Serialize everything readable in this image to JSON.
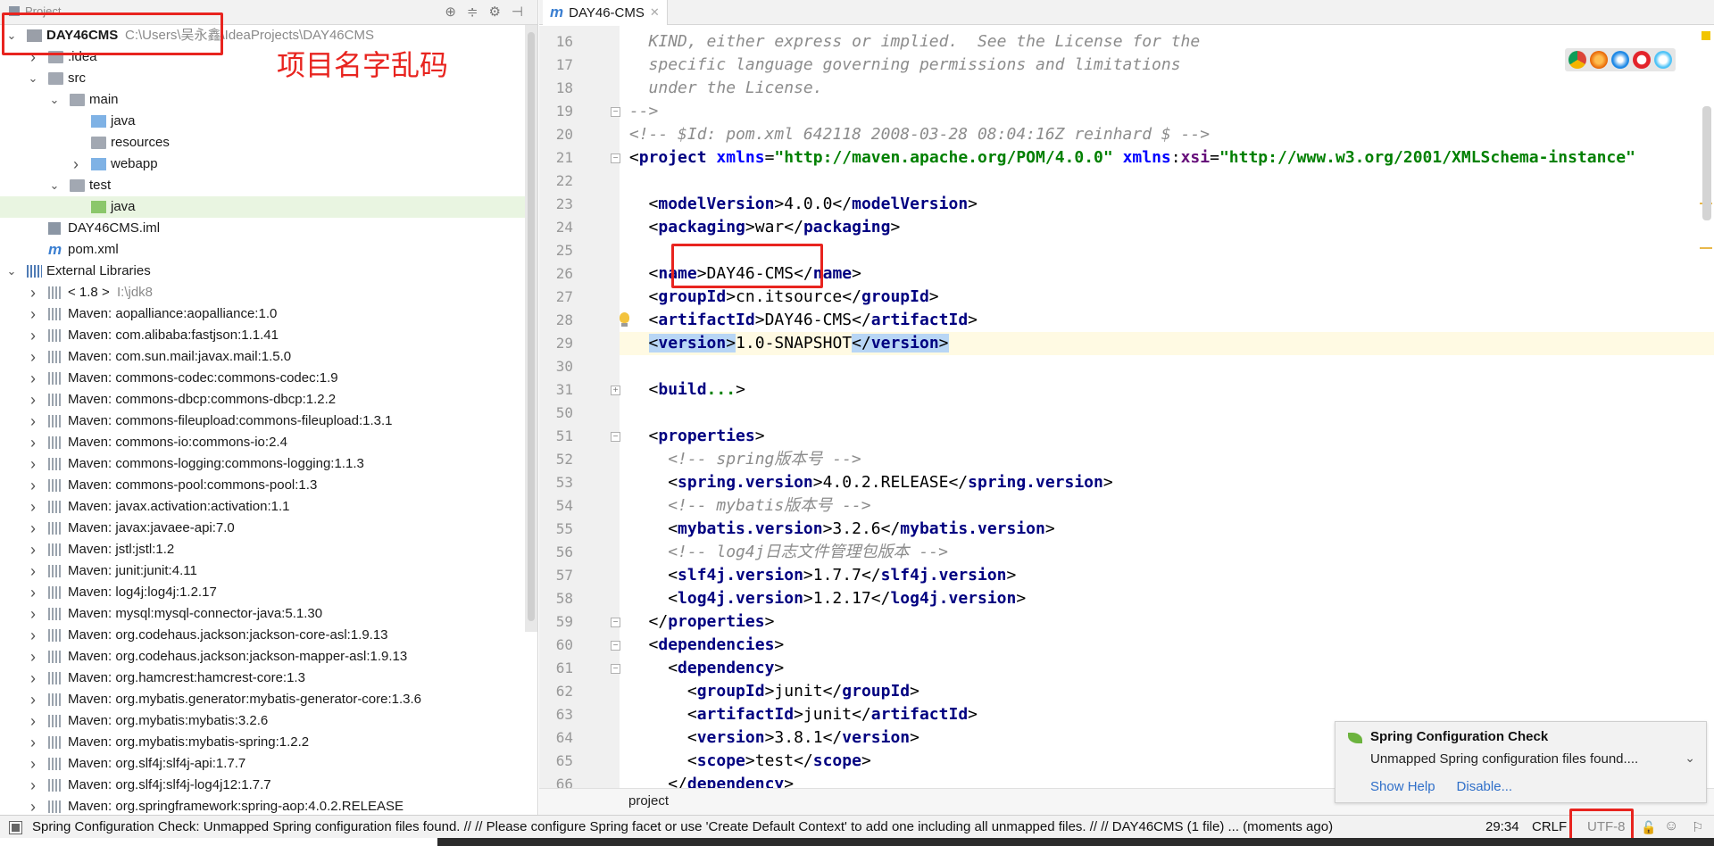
{
  "project_panel": {
    "title": "Project",
    "tree": [
      {
        "label": "DAY46CMS",
        "path": "C:\\Users\\吴永鑫\\IdeaProjects\\DAY46CMS",
        "level": 0,
        "arrow": "down",
        "icon": "folder-dark",
        "bold": true
      },
      {
        "label": ".idea",
        "level": 1,
        "arrow": "right",
        "icon": "folder"
      },
      {
        "label": "src",
        "level": 1,
        "arrow": "down",
        "icon": "folder"
      },
      {
        "label": "main",
        "level": 2,
        "arrow": "down",
        "icon": "folder"
      },
      {
        "label": "java",
        "level": 3,
        "arrow": "",
        "icon": "folder-blue"
      },
      {
        "label": "resources",
        "level": 3,
        "arrow": "",
        "icon": "folder"
      },
      {
        "label": "webapp",
        "level": 3,
        "arrow": "right",
        "icon": "folder-blue"
      },
      {
        "label": "test",
        "level": 2,
        "arrow": "down",
        "icon": "folder"
      },
      {
        "label": "java",
        "level": 3,
        "arrow": "",
        "icon": "folder-green",
        "selected": true
      },
      {
        "label": "DAY46CMS.iml",
        "level": 1,
        "arrow": "",
        "icon": "iml"
      },
      {
        "label": "pom.xml",
        "level": 1,
        "arrow": "",
        "icon": "m"
      },
      {
        "label": "External Libraries",
        "level": 0,
        "arrow": "down",
        "icon": "xlib"
      },
      {
        "label": "< 1.8 >",
        "path": "I:\\jdk8",
        "level": 1,
        "arrow": "right",
        "icon": "lib"
      },
      {
        "label": "Maven: aopalliance:aopalliance:1.0",
        "level": 1,
        "arrow": "right",
        "icon": "lib"
      },
      {
        "label": "Maven: com.alibaba:fastjson:1.1.41",
        "level": 1,
        "arrow": "right",
        "icon": "lib"
      },
      {
        "label": "Maven: com.sun.mail:javax.mail:1.5.0",
        "level": 1,
        "arrow": "right",
        "icon": "lib"
      },
      {
        "label": "Maven: commons-codec:commons-codec:1.9",
        "level": 1,
        "arrow": "right",
        "icon": "lib"
      },
      {
        "label": "Maven: commons-dbcp:commons-dbcp:1.2.2",
        "level": 1,
        "arrow": "right",
        "icon": "lib"
      },
      {
        "label": "Maven: commons-fileupload:commons-fileupload:1.3.1",
        "level": 1,
        "arrow": "right",
        "icon": "lib"
      },
      {
        "label": "Maven: commons-io:commons-io:2.4",
        "level": 1,
        "arrow": "right",
        "icon": "lib"
      },
      {
        "label": "Maven: commons-logging:commons-logging:1.1.3",
        "level": 1,
        "arrow": "right",
        "icon": "lib"
      },
      {
        "label": "Maven: commons-pool:commons-pool:1.3",
        "level": 1,
        "arrow": "right",
        "icon": "lib"
      },
      {
        "label": "Maven: javax.activation:activation:1.1",
        "level": 1,
        "arrow": "right",
        "icon": "lib"
      },
      {
        "label": "Maven: javax:javaee-api:7.0",
        "level": 1,
        "arrow": "right",
        "icon": "lib"
      },
      {
        "label": "Maven: jstl:jstl:1.2",
        "level": 1,
        "arrow": "right",
        "icon": "lib"
      },
      {
        "label": "Maven: junit:junit:4.11",
        "level": 1,
        "arrow": "right",
        "icon": "lib"
      },
      {
        "label": "Maven: log4j:log4j:1.2.17",
        "level": 1,
        "arrow": "right",
        "icon": "lib"
      },
      {
        "label": "Maven: mysql:mysql-connector-java:5.1.30",
        "level": 1,
        "arrow": "right",
        "icon": "lib"
      },
      {
        "label": "Maven: org.codehaus.jackson:jackson-core-asl:1.9.13",
        "level": 1,
        "arrow": "right",
        "icon": "lib"
      },
      {
        "label": "Maven: org.codehaus.jackson:jackson-mapper-asl:1.9.13",
        "level": 1,
        "arrow": "right",
        "icon": "lib"
      },
      {
        "label": "Maven: org.hamcrest:hamcrest-core:1.3",
        "level": 1,
        "arrow": "right",
        "icon": "lib"
      },
      {
        "label": "Maven: org.mybatis.generator:mybatis-generator-core:1.3.6",
        "level": 1,
        "arrow": "right",
        "icon": "lib"
      },
      {
        "label": "Maven: org.mybatis:mybatis:3.2.6",
        "level": 1,
        "arrow": "right",
        "icon": "lib"
      },
      {
        "label": "Maven: org.mybatis:mybatis-spring:1.2.2",
        "level": 1,
        "arrow": "right",
        "icon": "lib"
      },
      {
        "label": "Maven: org.slf4j:slf4j-api:1.7.7",
        "level": 1,
        "arrow": "right",
        "icon": "lib"
      },
      {
        "label": "Maven: org.slf4j:slf4j-log4j12:1.7.7",
        "level": 1,
        "arrow": "right",
        "icon": "lib"
      },
      {
        "label": "Maven: org.springframework:spring-aop:4.0.2.RELEASE",
        "level": 1,
        "arrow": "right",
        "icon": "lib"
      }
    ]
  },
  "annotation": {
    "text": "项目名字乱码",
    "color": "#e8241f"
  },
  "editor": {
    "tab_label": "DAY46-CMS",
    "breadcrumb": "project",
    "lines": [
      {
        "n": "16",
        "tokens": [
          [
            "  KIND, either express or implied.  See the License for the",
            "cm"
          ]
        ]
      },
      {
        "n": "17",
        "tokens": [
          [
            "  specific language governing permissions and limitations",
            "cm"
          ]
        ]
      },
      {
        "n": "18",
        "tokens": [
          [
            "  under the License.",
            "cm"
          ]
        ]
      },
      {
        "n": "19",
        "tokens": [
          [
            "-->",
            "cm"
          ]
        ],
        "fold": "-"
      },
      {
        "n": "20",
        "tokens": [
          [
            "<!-- $Id: pom.xml 642118 2008-03-28 08:04:16Z reinhard $ -->",
            "cm"
          ]
        ]
      },
      {
        "n": "21",
        "tokens": [
          [
            "<",
            "tx"
          ],
          [
            "project ",
            "tb"
          ],
          [
            "xmlns",
            "at"
          ],
          [
            "=",
            "tx"
          ],
          [
            "\"http://maven.apache.org/POM/4.0.0\" ",
            "st"
          ],
          [
            "xmlns",
            "at"
          ],
          [
            ":",
            "tx"
          ],
          [
            "xsi",
            "ns"
          ],
          [
            "=",
            "tx"
          ],
          [
            "\"http://www.w3.org/2001/XMLSchema-instance\"",
            "st"
          ]
        ],
        "fold": "-"
      },
      {
        "n": "22",
        "tokens": []
      },
      {
        "n": "23",
        "tokens": [
          [
            "  <",
            "tx"
          ],
          [
            "modelVersion",
            "tb"
          ],
          [
            ">4.0.0</",
            "tx"
          ],
          [
            "modelVersion",
            "tb"
          ],
          [
            ">",
            "tx"
          ]
        ]
      },
      {
        "n": "24",
        "tokens": [
          [
            "  <",
            "tx"
          ],
          [
            "packaging",
            "tb"
          ],
          [
            ">war</",
            "tx"
          ],
          [
            "packaging",
            "tb"
          ],
          [
            ">",
            "tx"
          ]
        ]
      },
      {
        "n": "25",
        "tokens": []
      },
      {
        "n": "26",
        "tokens": [
          [
            "  <",
            "tx"
          ],
          [
            "name",
            "tb"
          ],
          [
            ">DAY46-CMS</",
            "tx"
          ],
          [
            "name",
            "tb"
          ],
          [
            ">",
            "tx"
          ]
        ]
      },
      {
        "n": "27",
        "tokens": [
          [
            "  <",
            "tx"
          ],
          [
            "groupId",
            "tb"
          ],
          [
            ">cn.itsource</",
            "tx"
          ],
          [
            "groupId",
            "tb"
          ],
          [
            ">",
            "tx"
          ]
        ]
      },
      {
        "n": "28",
        "tokens": [
          [
            "  <",
            "tx"
          ],
          [
            "artifactId",
            "tb"
          ],
          [
            ">DAY46-CMS</",
            "tx"
          ],
          [
            "artifactId",
            "tb"
          ],
          [
            ">",
            "tx"
          ]
        ],
        "bulb": true
      },
      {
        "n": "29",
        "tokens": [
          [
            "  ",
            "tx"
          ],
          [
            "<",
            "tx",
            "sel"
          ],
          [
            "version",
            "tb",
            "sel"
          ],
          [
            ">",
            "tx",
            "sel"
          ],
          [
            "1.0-SNAPSHOT",
            "tx"
          ],
          [
            "</",
            "tx",
            "sel"
          ],
          [
            "version",
            "tb",
            "sel"
          ],
          [
            ">",
            "tx",
            "sel"
          ]
        ],
        "highlight": true
      },
      {
        "n": "30",
        "tokens": []
      },
      {
        "n": "31",
        "tokens": [
          [
            "  <",
            "tx"
          ],
          [
            "build",
            "tb"
          ],
          [
            "...",
            "st"
          ],
          [
            ">",
            "tx"
          ]
        ],
        "fold": "+"
      },
      {
        "n": "50",
        "tokens": []
      },
      {
        "n": "51",
        "tokens": [
          [
            "  <",
            "tx"
          ],
          [
            "properties",
            "tb"
          ],
          [
            ">",
            "tx"
          ]
        ],
        "fold": "-"
      },
      {
        "n": "52",
        "tokens": [
          [
            "    <!-- spring版本号 -->",
            "cm"
          ]
        ]
      },
      {
        "n": "53",
        "tokens": [
          [
            "    <",
            "tx"
          ],
          [
            "spring.version",
            "tb"
          ],
          [
            ">4.0.2.RELEASE</",
            "tx"
          ],
          [
            "spring.version",
            "tb"
          ],
          [
            ">",
            "tx"
          ]
        ]
      },
      {
        "n": "54",
        "tokens": [
          [
            "    <!-- mybatis版本号 -->",
            "cm"
          ]
        ]
      },
      {
        "n": "55",
        "tokens": [
          [
            "    <",
            "tx"
          ],
          [
            "mybatis.version",
            "tb"
          ],
          [
            ">3.2.6</",
            "tx"
          ],
          [
            "mybatis.version",
            "tb"
          ],
          [
            ">",
            "tx"
          ]
        ]
      },
      {
        "n": "56",
        "tokens": [
          [
            "    <!-- log4j日志文件管理包版本 -->",
            "cm"
          ]
        ]
      },
      {
        "n": "57",
        "tokens": [
          [
            "    <",
            "tx"
          ],
          [
            "slf4j.version",
            "tb"
          ],
          [
            ">1.7.7</",
            "tx"
          ],
          [
            "slf4j.version",
            "tb"
          ],
          [
            ">",
            "tx"
          ]
        ]
      },
      {
        "n": "58",
        "tokens": [
          [
            "    <",
            "tx"
          ],
          [
            "log4j.version",
            "tb"
          ],
          [
            ">1.2.17</",
            "tx"
          ],
          [
            "log4j.version",
            "tb"
          ],
          [
            ">",
            "tx"
          ]
        ]
      },
      {
        "n": "59",
        "tokens": [
          [
            "  </",
            "tx"
          ],
          [
            "properties",
            "tb"
          ],
          [
            ">",
            "tx"
          ]
        ],
        "fold": "-"
      },
      {
        "n": "60",
        "tokens": [
          [
            "  <",
            "tx"
          ],
          [
            "dependencies",
            "tb"
          ],
          [
            ">",
            "tx"
          ]
        ],
        "fold": "-"
      },
      {
        "n": "61",
        "tokens": [
          [
            "    <",
            "tx"
          ],
          [
            "dependency",
            "tb"
          ],
          [
            ">",
            "tx"
          ]
        ],
        "fold": "-"
      },
      {
        "n": "62",
        "tokens": [
          [
            "      <",
            "tx"
          ],
          [
            "groupId",
            "tb"
          ],
          [
            ">junit</",
            "tx"
          ],
          [
            "groupId",
            "tb"
          ],
          [
            ">",
            "tx"
          ]
        ]
      },
      {
        "n": "63",
        "tokens": [
          [
            "      <",
            "tx"
          ],
          [
            "artifactId",
            "tb"
          ],
          [
            ">junit</",
            "tx"
          ],
          [
            "artifactId",
            "tb"
          ],
          [
            ">",
            "tx"
          ]
        ]
      },
      {
        "n": "64",
        "tokens": [
          [
            "      <",
            "tx"
          ],
          [
            "version",
            "tb"
          ],
          [
            ">3.8.1</",
            "tx"
          ],
          [
            "version",
            "tb"
          ],
          [
            ">",
            "tx"
          ]
        ]
      },
      {
        "n": "65",
        "tokens": [
          [
            "      <",
            "tx"
          ],
          [
            "scope",
            "tb"
          ],
          [
            ">test</",
            "tx"
          ],
          [
            "scope",
            "tb"
          ],
          [
            ">",
            "tx"
          ]
        ]
      },
      {
        "n": "66",
        "tokens": [
          [
            "    </",
            "tx"
          ],
          [
            "dependency",
            "tb"
          ],
          [
            ">",
            "tx"
          ]
        ]
      }
    ]
  },
  "notification": {
    "title": "Spring Configuration Check",
    "body": "Unmapped Spring configuration files found....",
    "links": [
      "Show Help",
      "Disable..."
    ]
  },
  "status_bar": {
    "message": "Spring Configuration Check: Unmapped Spring configuration files found. // // Please configure Spring facet or use 'Create Default Context' to add one including all unmapped files. // // DAY46CMS (1 file)    ... (moments ago)",
    "position": "29:34",
    "line_sep": "CRLF",
    "encoding": "UTF-8"
  },
  "colors": {
    "annotation_red": "#e8241f",
    "tag": "#000080",
    "string": "#008000",
    "comment": "#8c8c8c",
    "selection": "#b8d6f5",
    "current_line": "#fffae3"
  }
}
